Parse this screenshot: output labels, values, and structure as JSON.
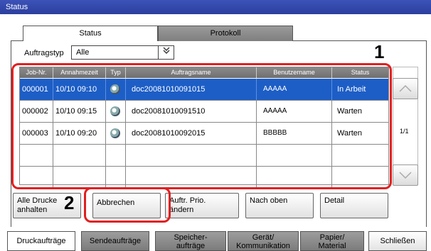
{
  "window": {
    "title": "Status"
  },
  "tabs": [
    {
      "label": "Status",
      "active": true
    },
    {
      "label": "Protokoll",
      "active": false
    }
  ],
  "filter": {
    "label": "Auftragstyp",
    "value": "Alle",
    "dropdown_icon": "chevron-double-down-icon"
  },
  "callouts": [
    "1",
    "2"
  ],
  "table": {
    "columns": [
      "Job-Nr.",
      "Annahmezeit",
      "Typ",
      "Auftragsname",
      "Benutzername",
      "Status"
    ],
    "rows": [
      {
        "job": "000001",
        "time": "10/10 09:10",
        "type_icon": "print-job-icon",
        "name": "doc20081010091015",
        "user": "AAAAA",
        "status": "In Arbeit",
        "selected": true
      },
      {
        "job": "000002",
        "time": "10/10 09:15",
        "type_icon": "print-job-icon",
        "name": "doc20081010091510",
        "user": "AAAAA",
        "status": "Warten",
        "selected": false
      },
      {
        "job": "000003",
        "time": "10/10 09:20",
        "type_icon": "print-job-icon",
        "name": "doc20081010092015",
        "user": "BBBBB",
        "status": "Warten",
        "selected": false
      }
    ]
  },
  "pager": {
    "text": "1/1",
    "up_icon": "chevron-up-icon",
    "down_icon": "chevron-down-icon"
  },
  "actions": {
    "hold_all_line1": "Alle Drucke",
    "hold_all_line2": "anhalten",
    "cancel": "Abbrechen",
    "priority_line1": "Auftr. Prio.",
    "priority_line2": "ändern",
    "move_up": "Nach oben",
    "detail": "Detail"
  },
  "bottom_tabs": {
    "print": "Druckaufträge",
    "send": "Sendeaufträge",
    "storage_line1": "Speicher-",
    "storage_line2": "aufträge",
    "device_line1": "Gerät/",
    "device_line2": "Kommunikation",
    "paper_line1": "Papier/",
    "paper_line2": "Material",
    "close": "Schließen"
  },
  "colors": {
    "titlebar": "#2b3f9e",
    "selection": "#1d5ec6",
    "callout_frame": "#e02020"
  }
}
